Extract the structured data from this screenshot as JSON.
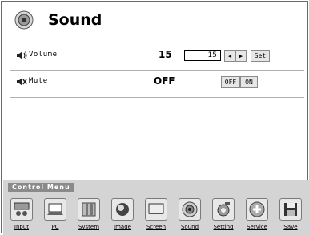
{
  "header": {
    "title": "Sound",
    "icon": "speaker-icon"
  },
  "settings": {
    "volume": {
      "label": "Volume",
      "value": "15",
      "input_value": "15",
      "set_label": "Set",
      "icon": "volume-icon"
    },
    "mute": {
      "label": "Mute",
      "value": "OFF",
      "off_label": "OFF",
      "on_label": "ON",
      "icon": "mute-icon"
    }
  },
  "control_menu": {
    "title": "Control Menu",
    "items": [
      {
        "label": "Input",
        "icon": "input-icon"
      },
      {
        "label": "PC",
        "icon": "pc-icon"
      },
      {
        "label": "System",
        "icon": "system-icon"
      },
      {
        "label": "Image",
        "icon": "image-icon"
      },
      {
        "label": "Screen",
        "icon": "screen-icon"
      },
      {
        "label": "Sound",
        "icon": "sound-icon"
      },
      {
        "label": "Setting",
        "icon": "setting-icon"
      },
      {
        "label": "Service",
        "icon": "service-icon"
      },
      {
        "label": "Save",
        "icon": "save-icon"
      }
    ]
  }
}
